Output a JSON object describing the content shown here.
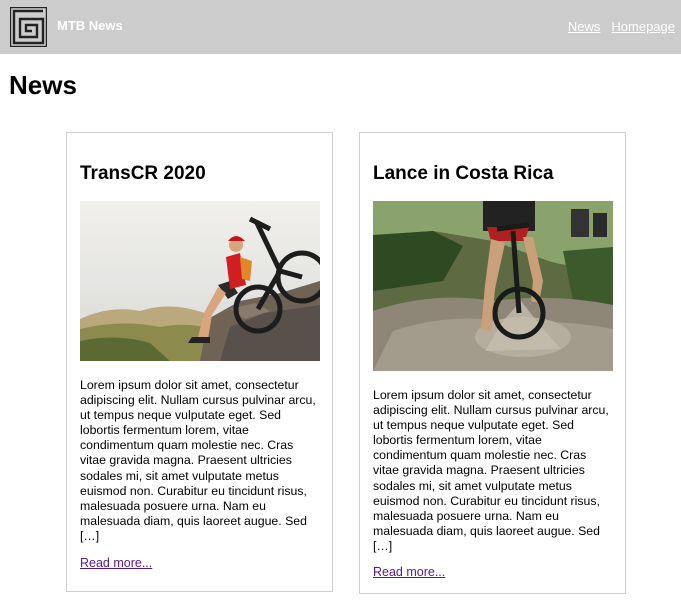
{
  "header": {
    "brand": "MTB News",
    "logo_icon": "square-spiral-logo-icon",
    "nav": [
      {
        "label": "News"
      },
      {
        "label": "Homepage"
      }
    ]
  },
  "page": {
    "title": "News"
  },
  "cards": [
    {
      "title": "TransCR 2020",
      "image": "mountain-biker-resting-on-rock-photo",
      "body": "Lorem ipsum dolor sit amet, consectetur adipiscing elit. Nullam cursus pulvinar arcu, ut tempus neque vulputate eget. Sed lobortis fermentum lorem, vitae condimentum quam molestie nec. Cras vitae gravida magna. Praesent ultricies sodales mi, sit amet vulputate metus euismod non. Curabitur eu tincidunt risus, malesuada posuere urna. Nam eu malesuada diam, quis laoreet augue. Sed […]",
      "link": "Read more..."
    },
    {
      "title": "Lance in Costa Rica",
      "image": "riders-splashing-through-mud-photo",
      "body": "Lorem ipsum dolor sit amet, consectetur adipiscing elit. Nullam cursus pulvinar arcu, ut tempus neque vulputate eget. Sed lobortis fermentum lorem, vitae condimentum quam molestie nec. Cras vitae gravida magna. Praesent ultricies sodales mi, sit amet vulputate metus euismod non. Curabitur eu tincidunt risus, malesuada posuere urna. Nam eu malesuada diam, quis laoreet augue. Sed […]",
      "link": "Read more..."
    }
  ],
  "colors": {
    "header_bg": "#cccccc",
    "header_text": "#ffffff",
    "visited_link": "#551a8b",
    "card_border": "#cfcfcf"
  }
}
